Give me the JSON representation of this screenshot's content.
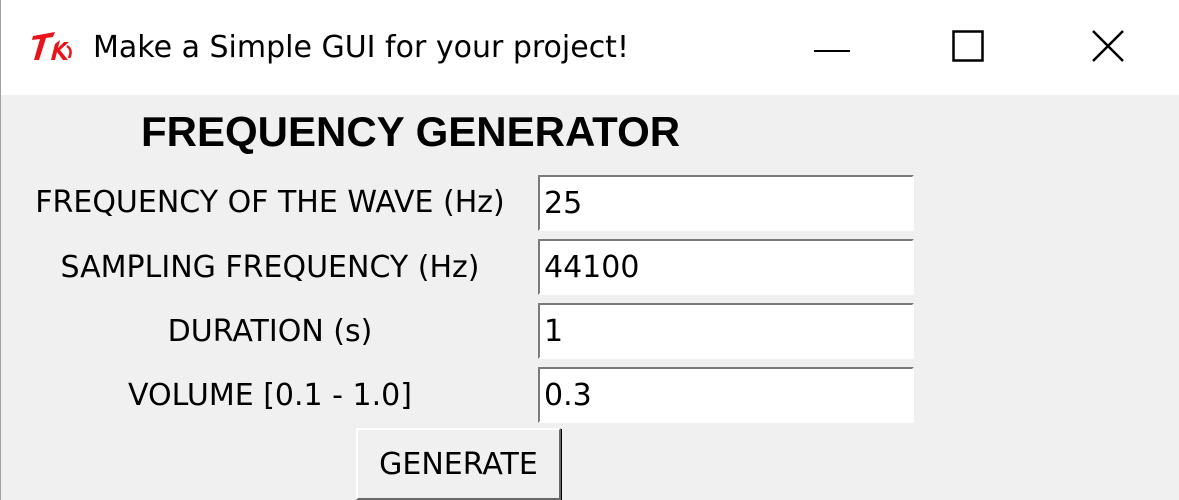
{
  "window": {
    "title": "Make a Simple GUI for your project!",
    "icon": "tk-feather-icon",
    "controls": [
      "minimize-icon",
      "maximize-icon",
      "close-icon"
    ]
  },
  "app": {
    "heading": "FREQUENCY GENERATOR",
    "fields": [
      {
        "label": "FREQUENCY OF THE WAVE (Hz)",
        "value": "25"
      },
      {
        "label": "SAMPLING FREQUENCY (Hz)",
        "value": "44100"
      },
      {
        "label": "DURATION (s)",
        "value": "1"
      },
      {
        "label": "VOLUME [0.1 - 1.0]",
        "value": "0.3"
      }
    ],
    "generate_label": "GENERATE"
  },
  "colors": {
    "window_bg": "#f0f0f0",
    "titlebar_bg": "#ffffff",
    "tk_icon": "#e8141c"
  }
}
